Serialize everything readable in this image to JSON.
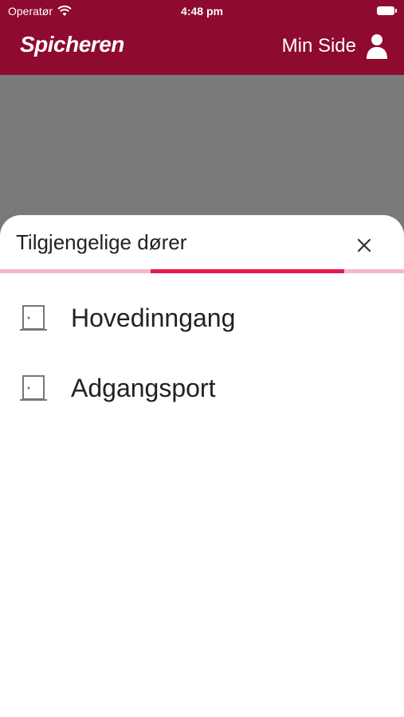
{
  "status_bar": {
    "carrier": "Operatør",
    "time": "4:48 pm",
    "icons": [
      "wifi-icon",
      "battery-icon"
    ]
  },
  "header": {
    "brand": "Spicheren",
    "my_page_label": "Min Side",
    "icon": "user-icon",
    "color": "#8e0a2f"
  },
  "sheet": {
    "title": "Tilgjengelige dører",
    "close_icon": "close-icon",
    "progress": {
      "start_fraction": 0.373,
      "end_fraction": 0.852,
      "track_color": "#f6b5c8",
      "fill_color": "#e8194e"
    },
    "doors": [
      {
        "label": "Hovedinngang",
        "icon": "door-icon"
      },
      {
        "label": "Adgangsport",
        "icon": "door-icon"
      }
    ]
  }
}
